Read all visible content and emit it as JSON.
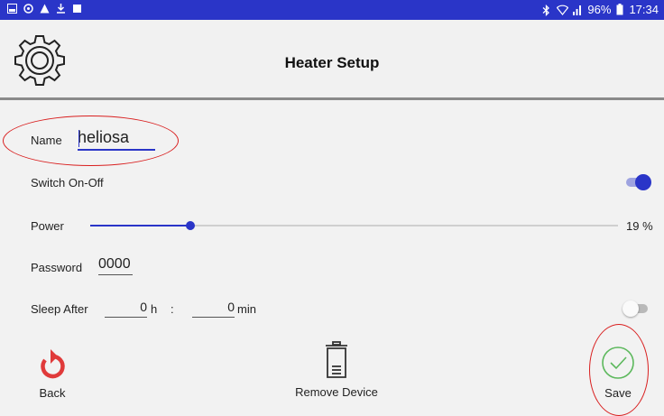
{
  "status_bar": {
    "left_icons": [
      "gallery-icon",
      "data-saver-icon",
      "warning-icon",
      "download-icon",
      "sd-card-icon"
    ],
    "right_icons": [
      "bluetooth-icon",
      "wifi-icon",
      "signal-icon"
    ],
    "battery": "96%",
    "time": "17:34"
  },
  "header": {
    "title": "Heater Setup",
    "icon": "gear-icon"
  },
  "form": {
    "name_label": "Name",
    "name_value": "heliosa",
    "switch_label": "Switch On-Off",
    "switch_on": true,
    "power_label": "Power",
    "power_value": 19,
    "power_text": "19 %",
    "password_label": "Password",
    "password_value": "0000",
    "sleep_label": "Sleep After",
    "sleep_hours": "0",
    "sleep_hours_unit": "h",
    "sleep_sep": ":",
    "sleep_minutes": "0",
    "sleep_minutes_unit": "min",
    "sleep_on": false
  },
  "actions": {
    "back_label": "Back",
    "remove_label": "Remove Device",
    "save_label": "Save"
  },
  "colors": {
    "accent": "#2a35c8",
    "annotation": "#d91f1f",
    "back_icon": "#e03a3a",
    "save_icon": "#5cb85c"
  }
}
